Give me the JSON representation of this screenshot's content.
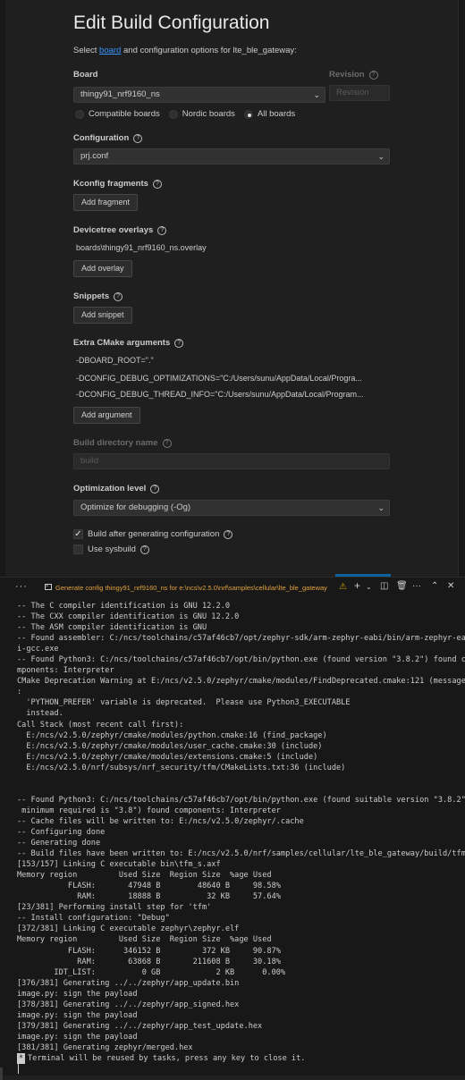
{
  "editor": {
    "title": "Edit Build Configuration",
    "intro_prefix": "Select ",
    "intro_link": "board",
    "intro_suffix": " and configuration options for lte_ble_gateway:",
    "board": {
      "label": "Board",
      "value": "thingy91_nrf9160_ns",
      "revision_label": "Revision",
      "revision_placeholder": "Revision",
      "filters": [
        {
          "label": "Compatible boards",
          "selected": false
        },
        {
          "label": "Nordic boards",
          "selected": false
        },
        {
          "label": "All boards",
          "selected": true
        }
      ]
    },
    "configuration": {
      "label": "Configuration",
      "value": "prj.conf"
    },
    "kconfig": {
      "label": "Kconfig fragments",
      "button": "Add fragment"
    },
    "devicetree": {
      "label": "Devicetree overlays",
      "item": "boards\\thingy91_nrf9160_ns.overlay",
      "button": "Add overlay"
    },
    "snippets": {
      "label": "Snippets",
      "button": "Add snippet"
    },
    "cmake": {
      "label": "Extra CMake arguments",
      "args": [
        "-DBOARD_ROOT=\".\"",
        "-DCONFIG_DEBUG_OPTIMIZATIONS=\"C:/Users/sunu/AppData/Local/Progra...",
        "-DCONFIG_DEBUG_THREAD_INFO=\"C:/Users/sunu/AppData/Local/Program..."
      ],
      "button": "Add argument"
    },
    "build_dir": {
      "label": "Build directory name",
      "placeholder": "build"
    },
    "optimization": {
      "label": "Optimization level",
      "value": "Optimize for debugging (-Og)"
    },
    "build_after": {
      "label": "Build after generating configuration",
      "checked": true
    },
    "sysbuild": {
      "label": "Use sysbuild",
      "checked": false
    }
  },
  "panel": {
    "tab_title": "Generate config thingy91_nrf9160_ns for e:\\ncs\\v2.5.0\\nrf\\samples\\cellular\\lte_ble_gateway",
    "icons": [
      "more-icon",
      "terminal-icon",
      "warning-icon",
      "add-icon",
      "chevron-down-icon",
      "split-icon",
      "trash-icon",
      "more-icon",
      "chevron-up-icon",
      "close-icon"
    ],
    "terminal_lines": [
      "-- The C compiler identification is GNU 12.2.0",
      "-- The CXX compiler identification is GNU 12.2.0",
      "-- The ASM compiler identification is GNU",
      "-- Found assembler: C:/ncs/toolchains/c57af46cb7/opt/zephyr-sdk/arm-zephyr-eabi/bin/arm-zephyr-eab",
      "i-gcc.exe",
      "-- Found Python3: C:/ncs/toolchains/c57af46cb7/opt/bin/python.exe (found version \"3.8.2\") found co",
      "mponents: Interpreter",
      "CMake Deprecation Warning at E:/ncs/v2.5.0/zephyr/cmake/modules/FindDeprecated.cmake:121 (message)",
      ":",
      "  'PYTHON_PREFER' variable is deprecated.  Please use Python3_EXECUTABLE",
      "  instead.",
      "Call Stack (most recent call first):",
      "  E:/ncs/v2.5.0/zephyr/cmake/modules/python.cmake:16 (find_package)",
      "  E:/ncs/v2.5.0/zephyr/cmake/modules/user_cache.cmake:30 (include)",
      "  E:/ncs/v2.5.0/zephyr/cmake/modules/extensions.cmake:5 (include)",
      "  E:/ncs/v2.5.0/nrf/subsys/nrf_security/tfm/CMakeLists.txt:36 (include)",
      "",
      "",
      "-- Found Python3: C:/ncs/toolchains/c57af46cb7/opt/bin/python.exe (found suitable version \"3.8.2\",",
      " minimum required is \"3.8\") found components: Interpreter",
      "-- Cache files will be written to: E:/ncs/v2.5.0/zephyr/.cache",
      "-- Configuring done",
      "-- Generating done",
      "-- Build files have been written to: E:/ncs/v2.5.0/nrf/samples/cellular/lte_ble_gateway/build/tfm",
      "[153/157] Linking C executable bin\\tfm_s.axf",
      "Memory region         Used Size  Region Size  %age Used",
      "           FLASH:       47948 B        48640 B     98.58%",
      "             RAM:       18888 B          32 KB     57.64%",
      "[23/381] Performing install step for 'tfm'",
      "-- Install configuration: \"Debug\"",
      "[372/381] Linking C executable zephyr\\zephyr.elf",
      "Memory region         Used Size  Region Size  %age Used",
      "           FLASH:      346152 B         372 KB     90.87%",
      "             RAM:       63868 B       211608 B     30.18%",
      "        IDT_LIST:          0 GB            2 KB      0.00%",
      "[376/381] Generating ../../zephyr/app_update.bin",
      "image.py: sign the payload",
      "[378/381] Generating ../../zephyr/app_signed.hex",
      "image.py: sign the payload",
      "[379/381] Generating ../../zephyr/app_test_update.hex",
      "image.py: sign the payload",
      "[381/381] Generating zephyr/merged.hex"
    ],
    "cursor_glyph": "*",
    "reuse_message": "Terminal will be reused by tasks, press any key to close it."
  }
}
